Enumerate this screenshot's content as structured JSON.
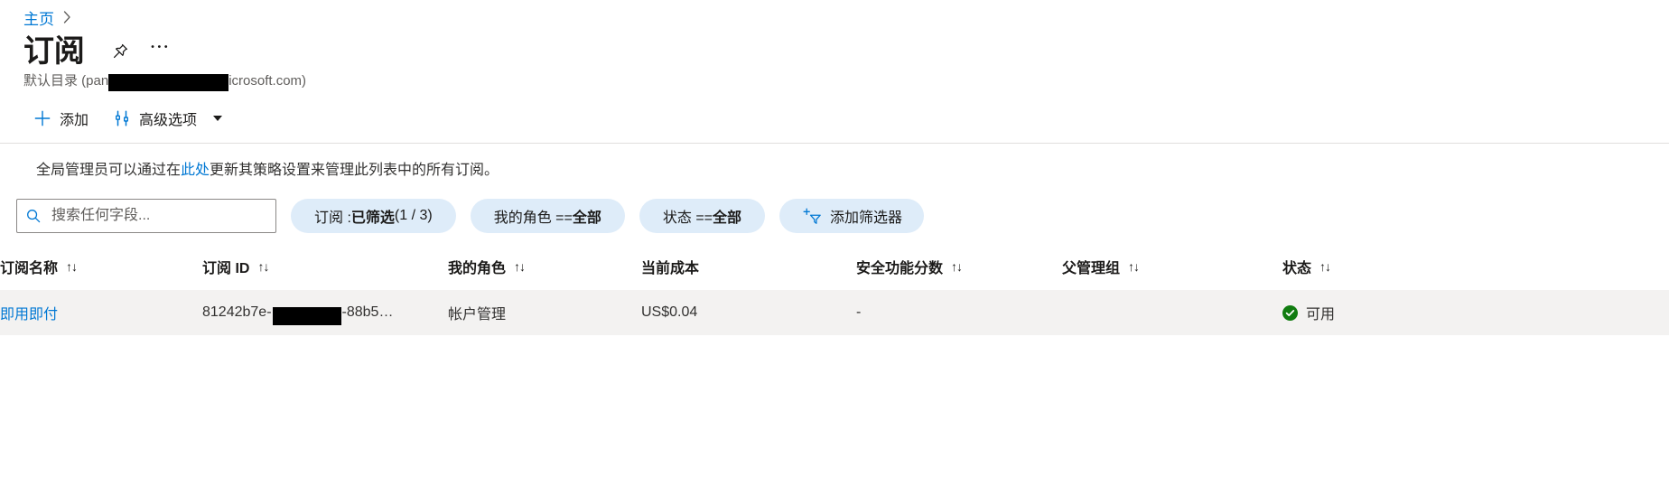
{
  "breadcrumb": {
    "home_label": "主页",
    "separator": "›"
  },
  "header": {
    "title": "订阅",
    "pin_icon": "pin-icon",
    "more_icon": "more-icon",
    "more_glyph": "⋯",
    "subtitle_prefix": "默认目录 (pan",
    "subtitle_suffix": "icrosoft.com)"
  },
  "command_bar": {
    "add_label": "添加",
    "add_icon": "plus-icon",
    "advanced_label": "高级选项",
    "advanced_icon": "settings-sliders-icon",
    "chevron_icon": "chevron-down-icon"
  },
  "info": {
    "text_before": "全局管理员可以通过在",
    "link_label": "此处",
    "text_after": "更新其策略设置来管理此列表中的所有订阅。"
  },
  "filters": {
    "search_placeholder": "搜索任何字段...",
    "search_value": "",
    "search_icon": "search-icon",
    "pills": [
      {
        "prefix": "订阅 : ",
        "bold": "已筛选",
        "suffix": " (1 / 3)",
        "name": "filter-pill-subscription"
      },
      {
        "prefix": "我的角色 == ",
        "bold": "全部",
        "suffix": "",
        "name": "filter-pill-my-role"
      },
      {
        "prefix": "状态 == ",
        "bold": "全部",
        "suffix": "",
        "name": "filter-pill-status"
      }
    ],
    "add_filter_label": "添加筛选器",
    "add_filter_icon": "add-filter-icon"
  },
  "table": {
    "sort_glyph": "↑↓",
    "columns": [
      {
        "label": "订阅名称",
        "sortable": true
      },
      {
        "label": "订阅 ID",
        "sortable": true
      },
      {
        "label": "我的角色",
        "sortable": true
      },
      {
        "label": "当前成本",
        "sortable": false
      },
      {
        "label": "安全功能分数",
        "sortable": true
      },
      {
        "label": "父管理组",
        "sortable": true
      },
      {
        "label": "状态",
        "sortable": true
      }
    ],
    "rows": [
      {
        "name": "即用即付",
        "id_prefix": "81242b7e-",
        "id_suffix": "-88b5…",
        "role": "帐户管理",
        "cost": "US$0.04",
        "secure_score": "-",
        "management_group": "",
        "status": "可用",
        "status_icon": "check-circle-icon"
      }
    ]
  },
  "colors": {
    "accent": "#0078d4",
    "pill_bg": "#deecf9",
    "row_alt_bg": "#f3f2f1",
    "success": "#107c10",
    "divider": "#e1dfdd",
    "text": "#1b1a19",
    "muted": "#605e5c"
  }
}
